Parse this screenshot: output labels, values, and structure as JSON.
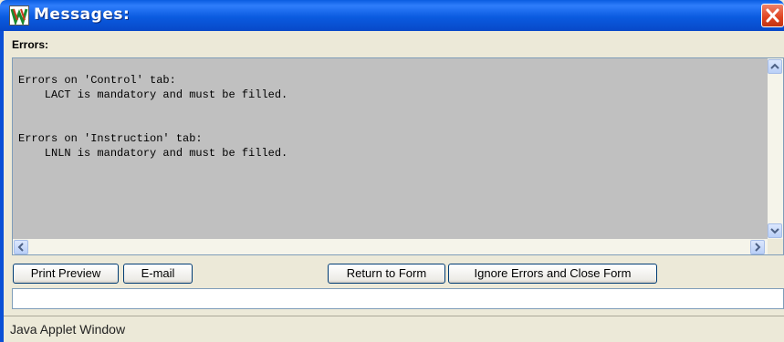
{
  "window": {
    "title": "Messages:",
    "app_icon": "vm-app-icon",
    "close_icon": "close-x-icon"
  },
  "errors_section": {
    "label": "Errors:",
    "text": "Errors on 'Control' tab:\n    LACT is mandatory and must be filled.\n\n\nErrors on 'Instruction' tab:\n    LNLN is mandatory and must be filled."
  },
  "buttons": {
    "print_preview": "Print Preview",
    "email": "E-mail",
    "return_to_form": "Return to Form",
    "ignore_errors": "Ignore Errors and Close Form"
  },
  "status_field": {
    "value": ""
  },
  "footer": {
    "label": "Java Applet Window"
  },
  "colors": {
    "titlebar": "#0a5ce0",
    "text_area_bg": "#c0c0c0",
    "close_button": "#e0431f",
    "window_bg": "#ece9d8"
  }
}
